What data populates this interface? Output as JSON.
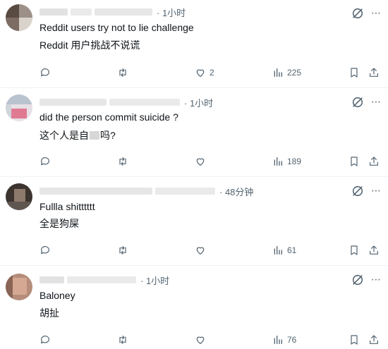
{
  "replies": [
    {
      "time": "· 1小时",
      "text": "Reddit users try not to lie challenge",
      "translation": "Reddit 用户挑战不说谎",
      "likes": "2",
      "views": "225"
    },
    {
      "time": "· 1小时",
      "text": "did the person commit suicide ?",
      "translation_pre": "这个人是自",
      "translation_post": "吗?",
      "likes": "",
      "views": "189"
    },
    {
      "time": "· 48分钟",
      "text": "Fullla shitttttt",
      "translation": "全是狗屎",
      "likes": "",
      "views": "61"
    },
    {
      "time": "· 1小时",
      "text": "Baloney",
      "translation": "胡扯",
      "likes": "",
      "views": "76"
    }
  ],
  "icons": {
    "reply": "reply-icon",
    "repost": "repost-icon",
    "like": "like-icon",
    "views": "views-icon",
    "bookmark": "bookmark-icon",
    "share": "share-icon",
    "grok": "grok-icon"
  },
  "colors": {
    "text": "#0f1419",
    "muted": "#536471",
    "divider": "#eff3f4"
  }
}
